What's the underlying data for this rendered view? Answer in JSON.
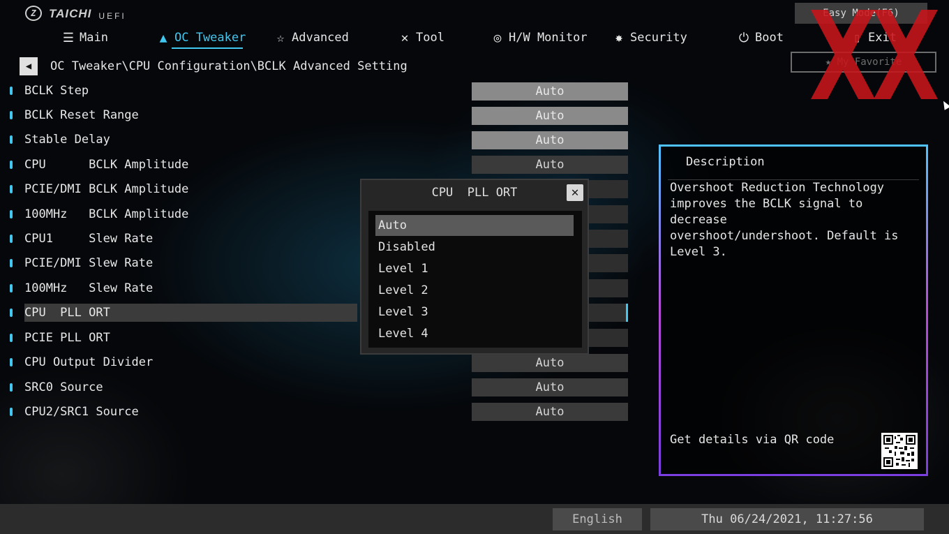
{
  "header": {
    "brand": "TAICHI",
    "subtitle": "UEFI",
    "easy_mode": "Easy Mode(F6)",
    "my_favorite": "My Favorite"
  },
  "nav": [
    {
      "label": "Main",
      "icon": "list-icon",
      "active": false
    },
    {
      "label": "OC Tweaker",
      "icon": "rocket-icon",
      "active": true
    },
    {
      "label": "Advanced",
      "icon": "star-advanced-icon",
      "active": false
    },
    {
      "label": "Tool",
      "icon": "tools-icon",
      "active": false
    },
    {
      "label": "H/W Monitor",
      "icon": "monitor-gauge-icon",
      "active": false
    },
    {
      "label": "Security",
      "icon": "shield-icon",
      "active": false
    },
    {
      "label": "Boot",
      "icon": "power-icon",
      "active": false
    },
    {
      "label": "Exit",
      "icon": "exit-door-icon",
      "active": false
    }
  ],
  "breadcrumb": "OC Tweaker\\CPU Configuration\\BCLK Advanced Setting",
  "settings": [
    {
      "label": "BCLK Step",
      "value": "Auto"
    },
    {
      "label": "BCLK Reset Range",
      "value": "Auto"
    },
    {
      "label": "Stable Delay",
      "value": "Auto"
    },
    {
      "label": "CPU      BCLK Amplitude",
      "value": "Auto"
    },
    {
      "label": "PCIE/DMI BCLK Amplitude",
      "value": "Auto"
    },
    {
      "label": "100MHz   BCLK Amplitude",
      "value": ""
    },
    {
      "label": "CPU1     Slew Rate",
      "value": ""
    },
    {
      "label": "PCIE/DMI Slew Rate",
      "value": ""
    },
    {
      "label": "100MHz   Slew Rate",
      "value": ""
    },
    {
      "label": "CPU  PLL ORT",
      "value": "",
      "selected": true
    },
    {
      "label": "PCIE PLL ORT",
      "value": ""
    },
    {
      "label": "CPU Output Divider",
      "value": "Auto"
    },
    {
      "label": "SRC0 Source",
      "value": "Auto"
    },
    {
      "label": "CPU2/SRC1 Source",
      "value": "Auto"
    }
  ],
  "popup": {
    "title": "CPU  PLL ORT",
    "options": [
      "Auto",
      "Disabled",
      "Level 1",
      "Level 2",
      "Level 3",
      "Level 4"
    ],
    "selected": "Auto"
  },
  "description": {
    "title": "Description",
    "lines": [
      "Overshoot Reduction Technology",
      "improves the BCLK signal to decrease",
      "overshoot/undershoot. Default is",
      "Level 3."
    ],
    "qr_label": "Get details via QR code"
  },
  "footer": {
    "language": "English",
    "datetime": "Thu 06/24/2021, 11:27:56"
  },
  "colors": {
    "accent": "#41c7f0",
    "watermark": "#c8151b"
  }
}
